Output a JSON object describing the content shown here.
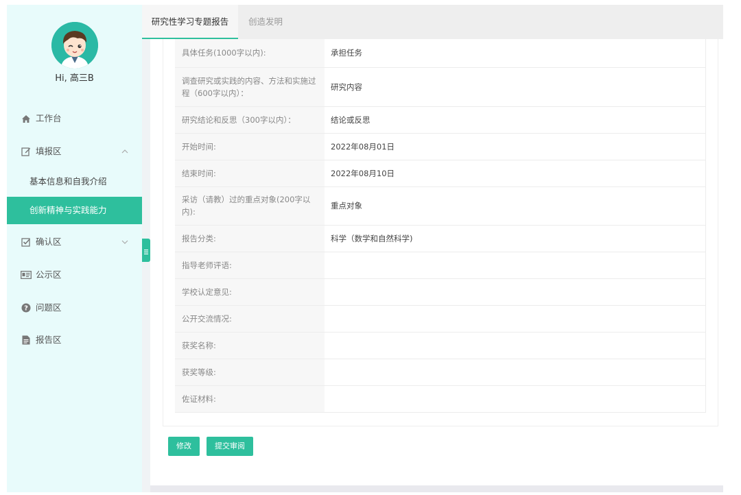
{
  "user": {
    "greeting": "Hi, 高三B"
  },
  "sidebar": {
    "items": [
      {
        "label": "工作台",
        "icon": "home-icon"
      },
      {
        "label": "填报区",
        "icon": "edit-icon",
        "expanded": true
      },
      {
        "label": "基本信息和自我介绍",
        "sub": true
      },
      {
        "label": "创新精神与实践能力",
        "sub": true,
        "active": true
      },
      {
        "label": "确认区",
        "icon": "checkbox-icon"
      },
      {
        "label": "公示区",
        "icon": "id-card-icon"
      },
      {
        "label": "问题区",
        "icon": "question-circle-icon"
      },
      {
        "label": "报告区",
        "icon": "file-icon"
      }
    ]
  },
  "tabs": [
    {
      "label": "研究性学习专题报告",
      "active": true
    },
    {
      "label": "创造发明",
      "active": false
    }
  ],
  "details": [
    {
      "label": "具体任务(1000字以内):",
      "value": "承担任务"
    },
    {
      "label": "调查研究或实践的内容、方法和实施过程（600字以内）：",
      "value": "研究内容"
    },
    {
      "label": "研究结论和反思（300字以内）：",
      "value": "结论或反思"
    },
    {
      "label": "开始时间:",
      "value": "2022年08月01日"
    },
    {
      "label": "结束时间:",
      "value": "2022年08月10日"
    },
    {
      "label": "采访（请教）过的重点对象(200字以内):",
      "value": "重点对象"
    },
    {
      "label": "报告分类:",
      "value": "科学（数学和自然科学)"
    },
    {
      "label": "指导老师评语:",
      "value": ""
    },
    {
      "label": "学校认定意见:",
      "value": ""
    },
    {
      "label": "公开交流情况:",
      "value": ""
    },
    {
      "label": "获奖名称:",
      "value": ""
    },
    {
      "label": "获奖等级:",
      "value": ""
    },
    {
      "label": "佐证材料:",
      "value": ""
    }
  ],
  "buttons": {
    "edit": "修改",
    "submit": "提交审阅"
  },
  "colors": {
    "accent": "#2ebf9d",
    "sidebar_bg": "#e8fbfb"
  }
}
